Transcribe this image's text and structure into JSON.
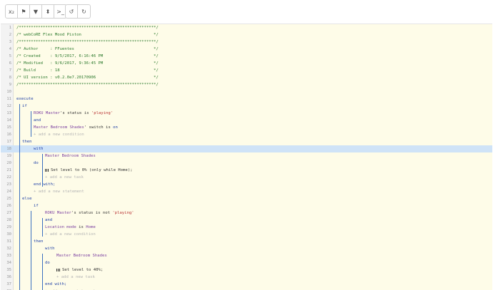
{
  "toolbar": [
    {
      "name": "subscript-toggle-button",
      "label": "x₂"
    },
    {
      "name": "pin-button",
      "label": "⚑"
    },
    {
      "name": "filter-button",
      "label": "▼"
    },
    {
      "name": "sort-button",
      "label": "⬍"
    },
    {
      "name": "terminal-button",
      "label": ">_"
    },
    {
      "name": "undo-button",
      "label": "↺"
    },
    {
      "name": "redo-button",
      "label": "↻"
    }
  ],
  "lines": [
    {
      "n": "1",
      "indent": 0,
      "parts": [
        {
          "t": "/*********************************************************/",
          "c": "com"
        }
      ]
    },
    {
      "n": "2",
      "indent": 0,
      "parts": [
        {
          "t": "/* webCoRE Flex Mood Piston                              */",
          "c": "com"
        }
      ]
    },
    {
      "n": "3",
      "indent": 0,
      "parts": [
        {
          "t": "/*********************************************************/",
          "c": "com"
        }
      ]
    },
    {
      "n": "4",
      "indent": 0,
      "parts": [
        {
          "t": "/* Author     : FFuentes                                 */",
          "c": "com"
        }
      ]
    },
    {
      "n": "5",
      "indent": 0,
      "parts": [
        {
          "t": "/* Created    : 9/5/2017, 6:16:46 PM                     */",
          "c": "com"
        }
      ]
    },
    {
      "n": "6",
      "indent": 0,
      "parts": [
        {
          "t": "/* Modified   : 9/6/2017, 9:36:45 PM                     */",
          "c": "com"
        }
      ]
    },
    {
      "n": "7",
      "indent": 0,
      "parts": [
        {
          "t": "/* Build      : 18                                       */",
          "c": "com"
        }
      ]
    },
    {
      "n": "8",
      "indent": 0,
      "parts": [
        {
          "t": "/* UI version : v0.2.0e7.20170906                        */",
          "c": "com"
        }
      ]
    },
    {
      "n": "9",
      "indent": 0,
      "parts": [
        {
          "t": "/*********************************************************/",
          "c": "com"
        }
      ]
    },
    {
      "n": "10",
      "indent": 0,
      "parts": []
    },
    {
      "n": "11",
      "indent": 0,
      "parts": [
        {
          "t": "execute",
          "c": "kw"
        }
      ]
    },
    {
      "n": "12",
      "indent": 1,
      "parts": [
        {
          "t": "if",
          "c": "kw"
        }
      ]
    },
    {
      "n": "13",
      "indent": 3,
      "parts": [
        {
          "t": "ROKU Master",
          "c": "dev"
        },
        {
          "t": "'s status is ",
          "c": "txt"
        },
        {
          "t": "'playing'",
          "c": "str"
        }
      ]
    },
    {
      "n": "14",
      "indent": 3,
      "parts": [
        {
          "t": "and",
          "c": "kw"
        }
      ]
    },
    {
      "n": "15",
      "indent": 3,
      "parts": [
        {
          "t": "Master Bedroom Shades",
          "c": "dev"
        },
        {
          "t": "' switch is ",
          "c": "txt"
        },
        {
          "t": "on",
          "c": "kw"
        }
      ]
    },
    {
      "n": "16",
      "indent": 3,
      "parts": [
        {
          "t": "+ add a new condition",
          "c": "dim"
        }
      ]
    },
    {
      "n": "17",
      "indent": 1,
      "parts": [
        {
          "t": "then",
          "c": "kw"
        }
      ]
    },
    {
      "n": "18",
      "indent": 3,
      "hl": true,
      "parts": [
        {
          "t": "with",
          "c": "kw"
        }
      ]
    },
    {
      "n": "19",
      "indent": 5,
      "parts": [
        {
          "t": "Master Bedroom Shades",
          "c": "dev"
        }
      ]
    },
    {
      "n": "20",
      "indent": 3,
      "parts": [
        {
          "t": "do",
          "c": "kw"
        }
      ]
    },
    {
      "n": "21",
      "indent": 5,
      "sig": true,
      "parts": [
        {
          "t": "Set level to 0% ",
          "c": "txt"
        },
        {
          "t": "(only while Home);",
          "c": "txt"
        }
      ]
    },
    {
      "n": "22",
      "indent": 5,
      "parts": [
        {
          "t": "+ add a new task",
          "c": "dim"
        }
      ]
    },
    {
      "n": "23",
      "indent": 3,
      "parts": [
        {
          "t": "end with;",
          "c": "kw"
        }
      ]
    },
    {
      "n": "24",
      "indent": 3,
      "parts": [
        {
          "t": "+ add a new statement",
          "c": "dim"
        }
      ]
    },
    {
      "n": "25",
      "indent": 1,
      "parts": [
        {
          "t": "else",
          "c": "kw"
        }
      ]
    },
    {
      "n": "26",
      "indent": 3,
      "parts": [
        {
          "t": "if",
          "c": "kw"
        }
      ]
    },
    {
      "n": "27",
      "indent": 5,
      "parts": [
        {
          "t": "ROKU Master",
          "c": "dev"
        },
        {
          "t": "'s status is not ",
          "c": "txt"
        },
        {
          "t": "'playing'",
          "c": "str"
        }
      ]
    },
    {
      "n": "28",
      "indent": 5,
      "parts": [
        {
          "t": "and",
          "c": "kw"
        }
      ]
    },
    {
      "n": "29",
      "indent": 5,
      "parts": [
        {
          "t": "Location mode",
          "c": "dev"
        },
        {
          "t": " is ",
          "c": "txt"
        },
        {
          "t": "Home",
          "c": "dev"
        }
      ]
    },
    {
      "n": "30",
      "indent": 5,
      "parts": [
        {
          "t": "+ add a new condition",
          "c": "dim"
        }
      ]
    },
    {
      "n": "31",
      "indent": 3,
      "parts": [
        {
          "t": "then",
          "c": "kw"
        }
      ]
    },
    {
      "n": "32",
      "indent": 5,
      "parts": [
        {
          "t": "with",
          "c": "kw"
        }
      ]
    },
    {
      "n": "33",
      "indent": 7,
      "parts": [
        {
          "t": "Master Bedroom Shades",
          "c": "dev"
        }
      ]
    },
    {
      "n": "34",
      "indent": 5,
      "parts": [
        {
          "t": "do",
          "c": "kw"
        }
      ]
    },
    {
      "n": "35",
      "indent": 7,
      "sig": true,
      "parts": [
        {
          "t": "Set level to 40%;",
          "c": "txt"
        }
      ]
    },
    {
      "n": "36",
      "indent": 7,
      "parts": [
        {
          "t": "+ add a new task",
          "c": "dim"
        }
      ]
    },
    {
      "n": "37",
      "indent": 5,
      "parts": [
        {
          "t": "end with;",
          "c": "kw"
        }
      ]
    },
    {
      "n": "38",
      "indent": 5,
      "parts": [
        {
          "t": "+ add a new statement",
          "c": "dim"
        }
      ]
    }
  ]
}
